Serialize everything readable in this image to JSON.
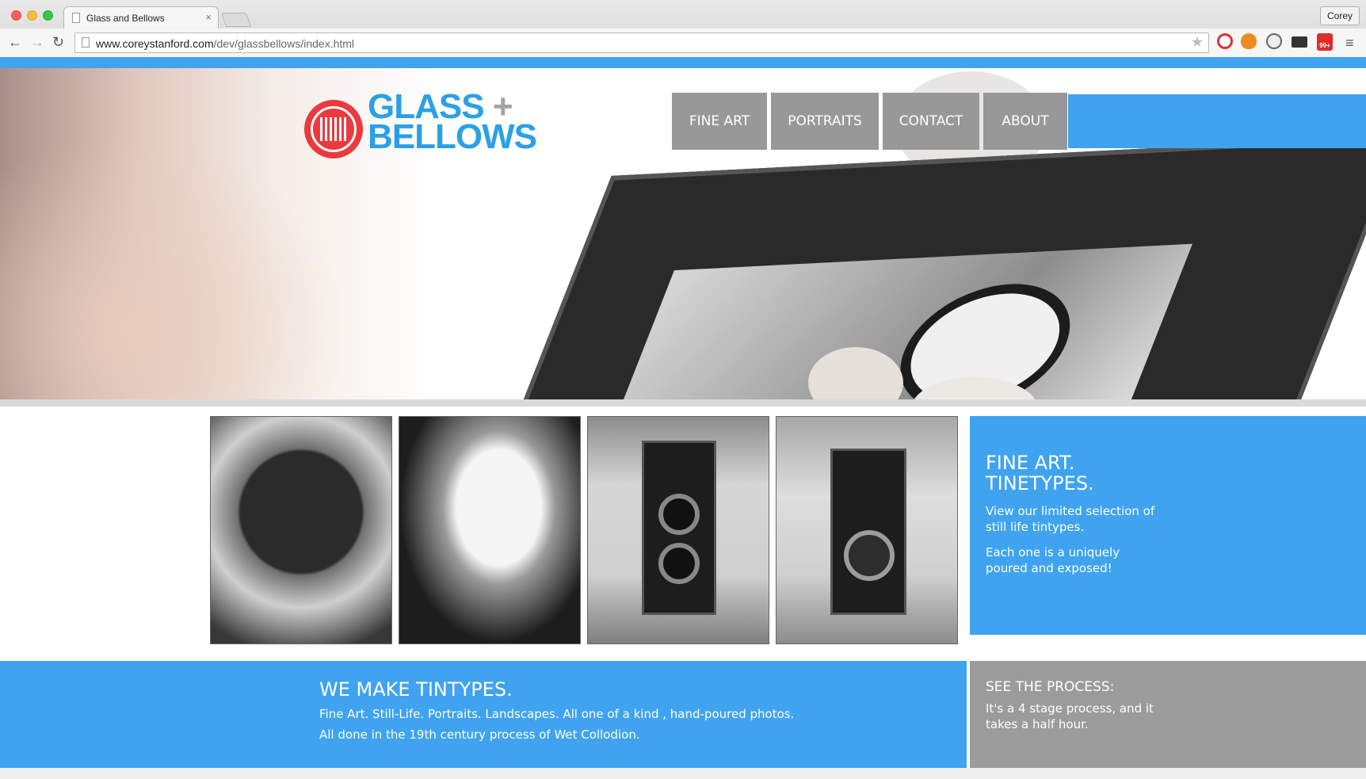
{
  "browser": {
    "tab_title": "Glass and Bellows",
    "tab_close": "×",
    "profile_name": "Corey",
    "url_host": "www.coreystanford.com",
    "url_path": "/dev/glassbellows/index.html",
    "back_icon": "←",
    "forward_icon": "→",
    "reload_icon": "↻",
    "star_icon": "★",
    "menu_icon": "≡",
    "ext_badge": "99+"
  },
  "logo": {
    "line1": "GLASS",
    "plus": "+",
    "line2": "BELLOWS",
    "brand_red": "#ea3a3e",
    "brand_blue": "#2aa0e6"
  },
  "nav": {
    "items": [
      {
        "label": "FINE ART"
      },
      {
        "label": "PORTRAITS"
      },
      {
        "label": "CONTACT"
      },
      {
        "label": "ABOUT"
      }
    ]
  },
  "colors": {
    "accent": "#3fa3ef",
    "nav_gray": "#989898"
  },
  "fine_art_panel": {
    "heading_line1": "FINE ART.",
    "heading_line2": "TINETYPES.",
    "text1": "View our limited selection of still life tintypes.",
    "text2": "Each one is a uniquely poured and exposed!"
  },
  "tintypes_panel": {
    "heading": "WE MAKE TINTYPES.",
    "text1": "Fine Art. Still-Life. Portraits. Landscapes. All one of a kind , hand-poured photos.",
    "text2": "All done in the 19th century process of Wet Collodion."
  },
  "process_panel": {
    "heading": "SEE THE PROCESS:",
    "text": "It's a 4 stage process, and it takes a half hour."
  }
}
